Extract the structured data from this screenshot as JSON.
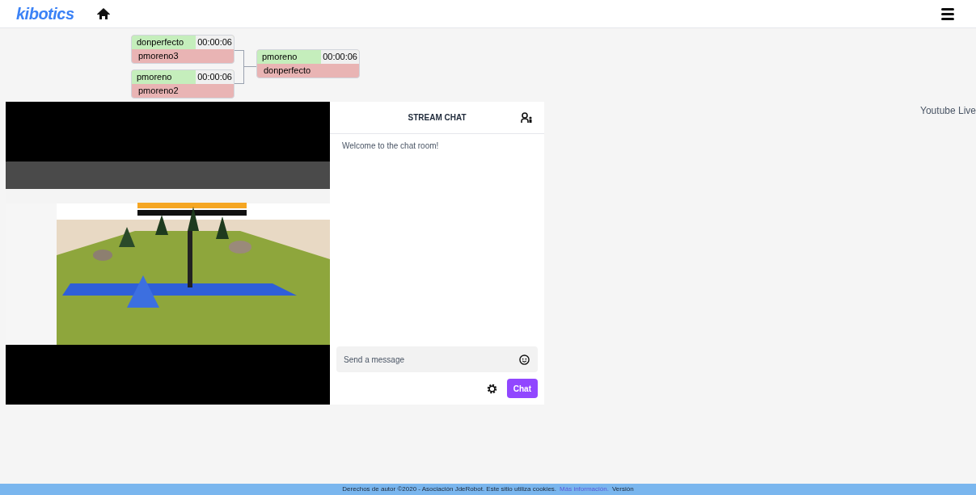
{
  "header": {
    "logo": "kibotics"
  },
  "bracket": {
    "rounds": [
      [
        {
          "winner": {
            "name": "donperfecto",
            "time": "00:00:06"
          },
          "loser": {
            "name": "pmoreno3"
          }
        },
        {
          "winner": {
            "name": "pmoreno",
            "time": "00:00:06"
          },
          "loser": {
            "name": "pmoreno2"
          }
        }
      ],
      [
        {
          "winner": {
            "name": "pmoreno",
            "time": "00:00:06"
          },
          "loser": {
            "name": "donperfecto"
          }
        }
      ]
    ]
  },
  "chat": {
    "title": "STREAM CHAT",
    "messages": [
      "Welcome to the chat room!"
    ],
    "input": {
      "placeholder": "Send a message"
    },
    "send_button": "Chat"
  },
  "side_label": "Youtube Live",
  "footer": {
    "text": "Derechos de autor ©2020 - Asociación JdeRobot. Este sitio utiliza cookies.",
    "link": "Más información.",
    "version": "Versión"
  }
}
